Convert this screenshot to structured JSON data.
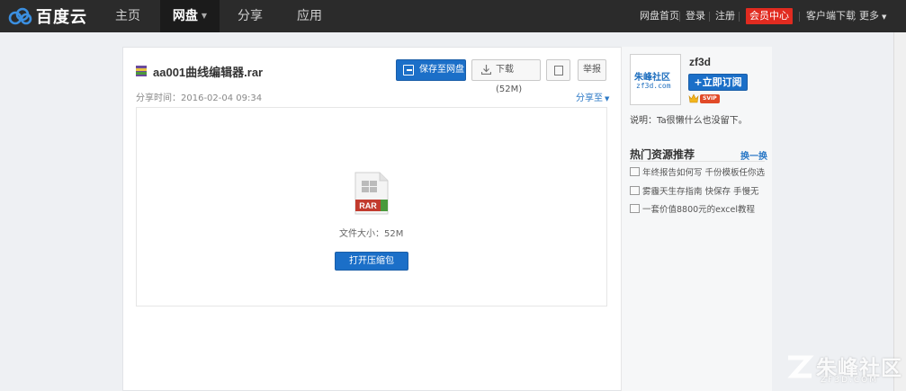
{
  "topnav": {
    "brand": "百度云",
    "tabs": [
      {
        "label": "主页"
      },
      {
        "label": "网盘"
      },
      {
        "label": "分享"
      },
      {
        "label": "应用"
      }
    ],
    "links": {
      "disk_home": "网盘首页",
      "login": "登录",
      "register": "注册",
      "vip_center": "会员中心",
      "client_download": "客户端下载",
      "more": "更多"
    }
  },
  "file": {
    "name": "aa001曲线编辑器.rar",
    "share_time": "分享时间：2016-02-04 09:34",
    "share_to": "分享至",
    "icon_label": "RAR",
    "size_text": "文件大小：52M"
  },
  "actions": {
    "save": "保存至网盘",
    "download": "下载(52M)",
    "report": "举报",
    "open_archive": "打开压缩包"
  },
  "sharer": {
    "avatar_text": "朱峰社区",
    "avatar_url_text": "zf3d.com",
    "name": "zf3d",
    "subscribe": "+立即订阅",
    "badge": "SVIP",
    "description": "说明：Ta很懒什么也没留下。"
  },
  "hot": {
    "title": "热门资源推荐",
    "refresh": "换一换",
    "items": [
      {
        "text": "年终报告如何写 千份模板任你选"
      },
      {
        "text": "雾霾天生存指南 快保存 手慢无"
      },
      {
        "text": "一套价值8800元的excel教程"
      }
    ]
  },
  "watermark": {
    "text": "朱峰社区",
    "sub": "ZF3D.COM"
  },
  "colors": {
    "nav_bg": "#2b2b2b",
    "accent_blue": "#1b6fc8",
    "vip_red": "#e12b20",
    "link_blue": "#2c79c6"
  }
}
